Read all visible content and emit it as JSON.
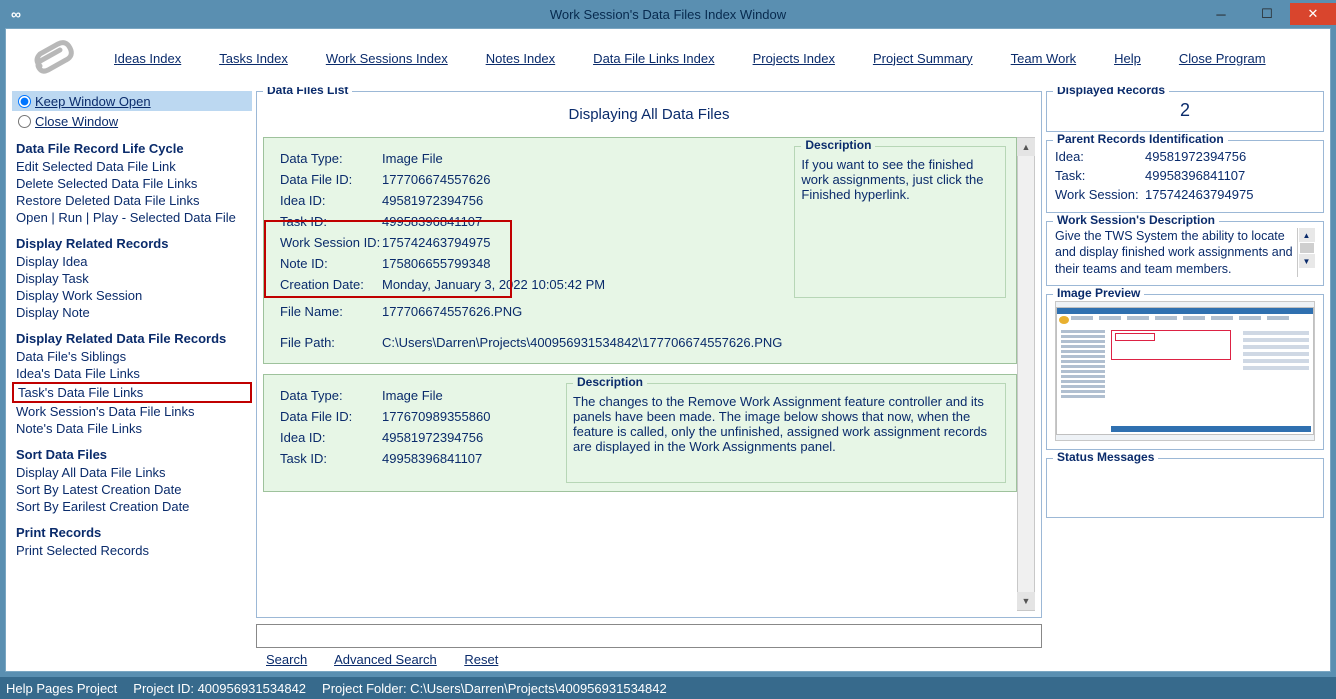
{
  "titlebar": {
    "title": "Work Session's Data Files Index Window",
    "icon": "∞"
  },
  "topmenu": {
    "ideas": "Ideas Index",
    "tasks": "Tasks Index",
    "worksessions": "Work Sessions Index",
    "notes": "Notes Index",
    "datafilelinks": "Data File Links Index",
    "projects": "Projects Index",
    "summary": "Project Summary",
    "team": "Team Work",
    "help": "Help",
    "close": "Close Program"
  },
  "left": {
    "keep_open": "Keep Window Open",
    "close_window": "Close Window",
    "h1": "Data File Record Life Cycle",
    "edit_sel": "Edit Selected Data File Link",
    "del_sel": "Delete Selected Data File Links",
    "restore": "Restore Deleted Data File Links",
    "openrun": "Open | Run | Play - Selected Data File",
    "h2": "Display Related Records",
    "disp_idea": "Display Idea",
    "disp_task": "Display Task",
    "disp_ws": "Display Work Session",
    "disp_note": "Display Note",
    "h3": "Display Related Data File Records",
    "siblings": "Data File's Siblings",
    "idea_links": "Idea's Data File Links",
    "task_links": "Task's Data File Links",
    "ws_links": "Work Session's Data File Links",
    "note_links": "Note's Data File Links",
    "h4": "Sort Data Files",
    "disp_all": "Display All Data File Links",
    "sort_latest": "Sort By Latest Creation Date",
    "sort_earliest": "Sort By Earilest Creation Date",
    "h5": "Print Records",
    "print_sel": "Print Selected Records"
  },
  "list_legend": "Data Files List",
  "list_title": "Displaying All Data Files",
  "card1": {
    "datatype_lbl": "Data Type:",
    "datatype": "Image File",
    "fileid_lbl": "Data File ID:",
    "fileid": "177706674557626",
    "idea_lbl": "Idea ID:",
    "idea": "49581972394756",
    "task_lbl": "Task ID:",
    "task": "49958396841107",
    "ws_lbl": "Work Session ID:",
    "ws": "175742463794975",
    "note_lbl": "Note ID:",
    "note": "175806655799348",
    "created_lbl": "Creation Date:",
    "created": "Monday, January 3, 2022   10:05:42 PM",
    "fname_lbl": "File Name:",
    "fname": "177706674557626.PNG",
    "fpath_lbl": "File Path:",
    "fpath": "C:\\Users\\Darren\\Projects\\400956931534842\\177706674557626.PNG",
    "desc_lbl": "Description",
    "desc": "If you want to see the finished work assignments, just click the Finished hyperlink."
  },
  "card2": {
    "datatype_lbl": "Data Type:",
    "datatype": "Image File",
    "fileid_lbl": "Data File ID:",
    "fileid": "177670989355860",
    "idea_lbl": "Idea ID:",
    "idea": "49581972394756",
    "task_lbl": "Task ID:",
    "task": "49958396841107",
    "desc_lbl": "Description",
    "desc": "The changes to the Remove Work Assignment feature controller and its panels have been made. The image below shows that now, when the feature is called, only the unfinished, assigned work assignment records are displayed in the Work Assignments panel."
  },
  "search": {
    "search": "Search",
    "adv": "Advanced Search",
    "reset": "Reset"
  },
  "right": {
    "disp_legend": "Displayed Records",
    "disp_count": "2",
    "parent_legend": "Parent Records Identification",
    "idea_lbl": "Idea:",
    "idea": "49581972394756",
    "task_lbl": "Task:",
    "task": "49958396841107",
    "ws_lbl": "Work Session:",
    "ws": "175742463794975",
    "wsdesc_legend": "Work Session's Description",
    "wsdesc": "Give the TWS System the ability to locate and display finished work assignments and their teams and team members.",
    "preview_legend": "Image Preview",
    "status_legend": "Status Messages"
  },
  "footer": {
    "help": "Help Pages Project",
    "projid": "Project ID:  400956931534842",
    "projfolder": "Project Folder:  C:\\Users\\Darren\\Projects\\400956931534842"
  }
}
